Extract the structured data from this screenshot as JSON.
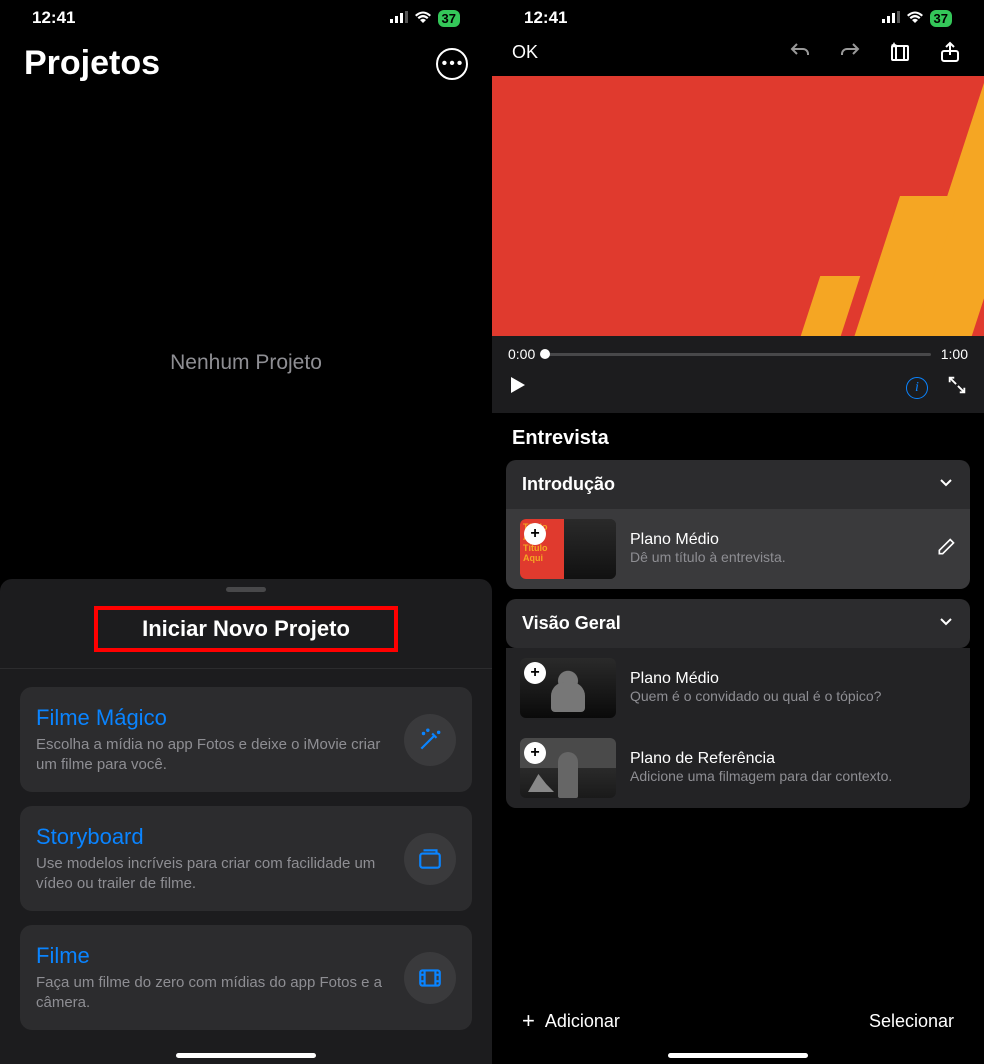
{
  "status": {
    "time": "12:41",
    "battery": "37"
  },
  "left": {
    "header_title": "Projetos",
    "empty_message": "Nenhum Projeto",
    "sheet_title": "Iniciar Novo Projeto",
    "options": [
      {
        "title": "Filme Mágico",
        "desc": "Escolha a mídia no app Fotos e deixe o iMovie criar um filme para você.",
        "icon": "magic-wand-icon"
      },
      {
        "title": "Storyboard",
        "desc": "Use modelos incríveis para criar com facilidade um vídeo ou trailer de filme.",
        "icon": "storyboard-icon"
      },
      {
        "title": "Filme",
        "desc": "Faça um filme do zero com mídias do app Fotos e a câmera.",
        "icon": "film-icon"
      }
    ]
  },
  "right": {
    "ok_label": "OK",
    "time_start": "0:00",
    "time_end": "1:00",
    "section_title": "Entrevista",
    "groups": [
      {
        "title": "Introdução",
        "clips": [
          {
            "title": "Plano Médio",
            "subtitle": "Dê um título à entrevista.",
            "editable": true,
            "thumb_text": "Título Aqui Título Aqui"
          }
        ]
      },
      {
        "title": "Visão Geral",
        "clips": [
          {
            "title": "Plano Médio",
            "subtitle": "Quem é o convidado ou qual é o tópico?",
            "editable": false
          },
          {
            "title": "Plano de Referência",
            "subtitle": "Adicione uma filmagem para dar contexto.",
            "editable": false
          }
        ]
      }
    ],
    "bottom": {
      "add": "Adicionar",
      "select": "Selecionar"
    }
  }
}
